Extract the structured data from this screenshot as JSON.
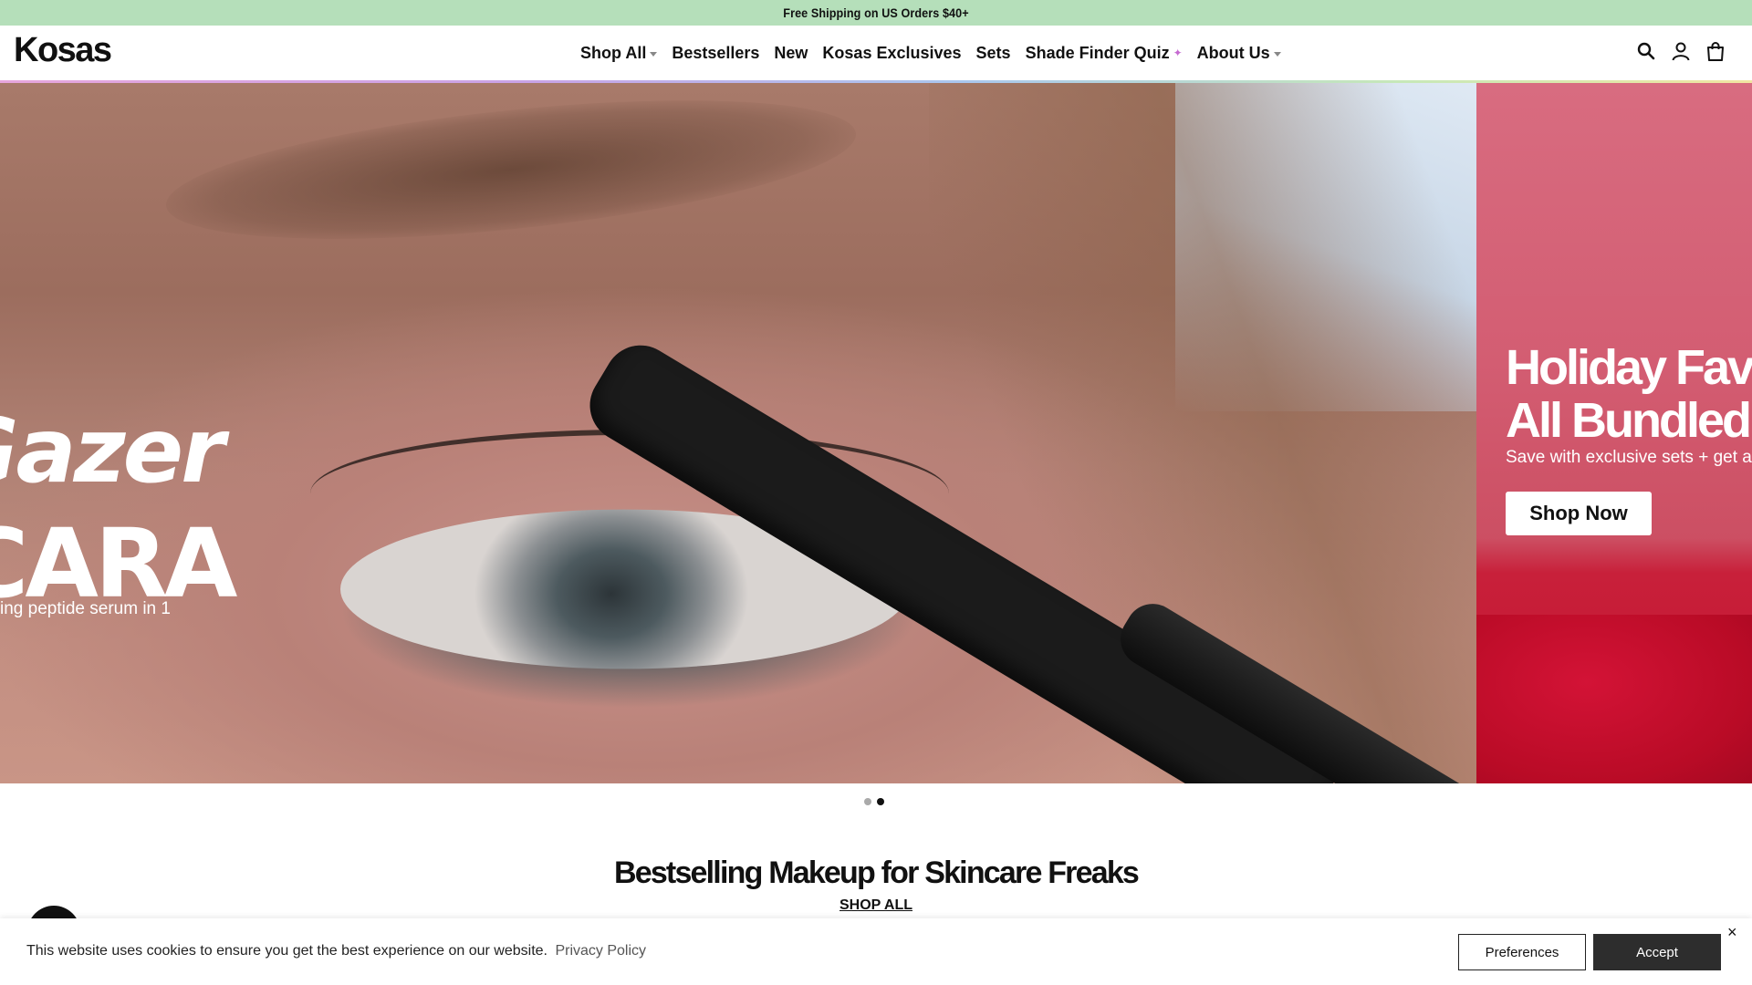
{
  "announcement": "Free Shipping on US Orders $40+",
  "header": {
    "logo": "Kosas",
    "nav": [
      {
        "label": "Shop All",
        "has_caret": true
      },
      {
        "label": "Bestsellers"
      },
      {
        "label": "New"
      },
      {
        "label": "Kosas Exclusives"
      },
      {
        "label": "Sets"
      },
      {
        "label": "Shade Finder Quiz",
        "sparkle": "✦"
      },
      {
        "label": "About Us",
        "has_caret": true
      }
    ],
    "icons": [
      "search-icon",
      "account-icon",
      "bag-icon"
    ]
  },
  "hero": {
    "slide1": {
      "line1": "Gazer",
      "line2": "CARA",
      "sub": "ing peptide serum in 1"
    },
    "slide2": {
      "title_line1": "Holiday Fav",
      "title_line2": "All Bundled",
      "sub": "Save with exclusive sets + get a fr",
      "button": "Shop Now"
    },
    "dots": 2,
    "active_dot": 1
  },
  "section": {
    "title": "Bestselling Makeup for Skincare Freaks",
    "link": "SHOP ALL"
  },
  "cookie": {
    "text": "This website uses cookies to ensure you get the best experience on our website.",
    "privacy_link": "Privacy Policy",
    "preferences": "Preferences",
    "accept": "Accept",
    "close": "×"
  },
  "colors": {
    "announcement_bg": "#b5dfba",
    "slide2_bg": "#d35d72",
    "accept_bg": "#2d2d2d"
  }
}
